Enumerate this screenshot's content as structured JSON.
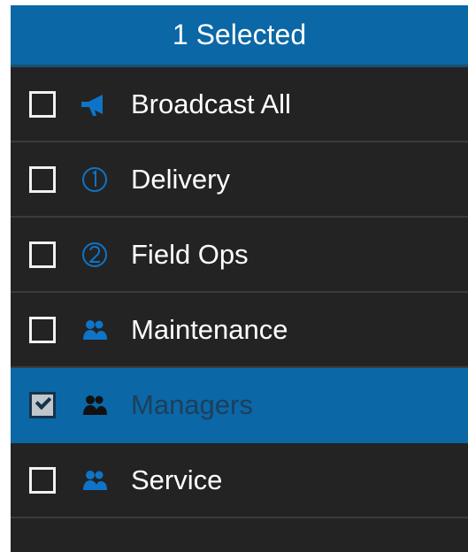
{
  "header": {
    "title": "1 Selected"
  },
  "items": [
    {
      "label": "Broadcast All",
      "icon": "megaphone-icon",
      "selected": false
    },
    {
      "label": "Delivery",
      "icon": "number-one-circle-icon",
      "selected": false
    },
    {
      "label": "Field Ops",
      "icon": "number-two-circle-icon",
      "selected": false
    },
    {
      "label": "Maintenance",
      "icon": "group-icon",
      "selected": false
    },
    {
      "label": "Managers",
      "icon": "group-icon",
      "selected": true
    },
    {
      "label": "Service",
      "icon": "group-icon",
      "selected": false
    }
  ],
  "colors": {
    "header_bg": "#0B67A6",
    "list_bg": "#232323",
    "selected_bg": "#0B67A6",
    "icon_blue": "#0E74C8",
    "selected_icon": "#111111"
  }
}
